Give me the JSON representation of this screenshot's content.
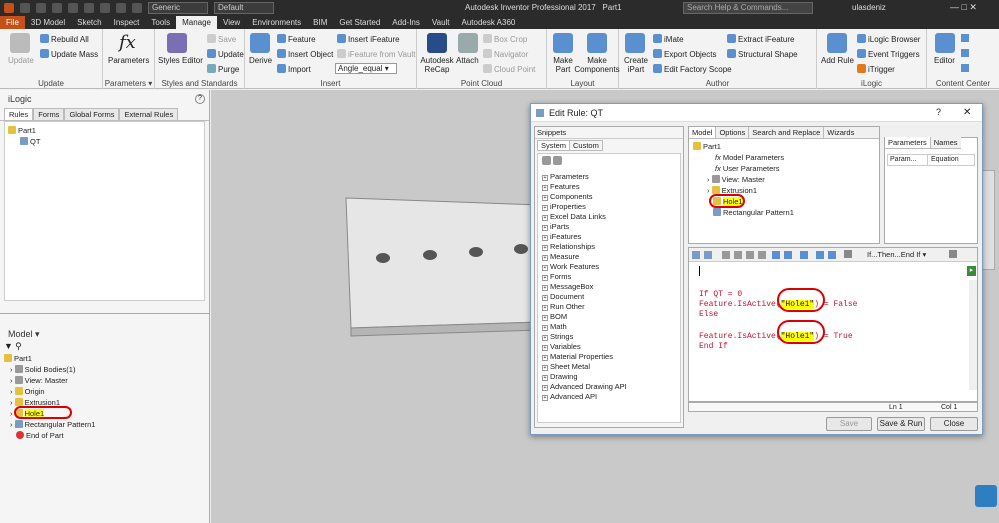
{
  "app": {
    "title": "Autodesk Inventor Professional 2017",
    "doc": "Part1",
    "search_placeholder": "Search Help & Commands...",
    "user": "ulasdeniz",
    "appearance": "Generic",
    "material": "Default"
  },
  "tabs": [
    "File",
    "3D Model",
    "Sketch",
    "Inspect",
    "Tools",
    "Manage",
    "View",
    "Environments",
    "BIM",
    "Get Started",
    "Add-Ins",
    "Vault",
    "Autodesk A360"
  ],
  "ribbon": {
    "update": {
      "update": "Update",
      "rebuild": "Rebuild All",
      "mass": "Update Mass",
      "title": "Update"
    },
    "params": {
      "label": "Parameters",
      "title": "Parameters ▾"
    },
    "styles": {
      "editor": "Styles Editor",
      "save": "Save",
      "update": "Update",
      "purge": "Purge",
      "title": "Styles and Standards"
    },
    "insert": {
      "derive": "Derive",
      "feature": "Feature",
      "object": "Insert Object",
      "import": "Import",
      "ifeature": "Insert iFeature",
      "ifeature_vault": "iFeature from Vault",
      "angle": "Angle_equal",
      "title": "Insert"
    },
    "pointcloud": {
      "recap": "Autodesk ReCap",
      "attach": "Attach",
      "boxcrop": "Box Crop",
      "navigator": "Navigator",
      "cloudpoint": "Cloud Point",
      "title": "Point Cloud"
    },
    "layout": {
      "make_part": "Make Part",
      "make_components": "Make Components",
      "title": "Layout"
    },
    "author": {
      "create": "Create iPart",
      "imate": "iMate",
      "export": "Export Objects",
      "edit_factory": "Edit Factory Scope",
      "extract": "Extract iFeature",
      "structural": "Structural Shape",
      "title": "Author"
    },
    "ilogic": {
      "add_rule": "Add Rule",
      "browser": "iLogic Browser",
      "triggers": "Event Triggers",
      "itrigger": "iTrigger",
      "title": "iLogic"
    },
    "cc": {
      "editor": "Editor",
      "title": "Content Center"
    }
  },
  "ilogic_pane": {
    "title": "iLogic",
    "tabs": [
      "Rules",
      "Forms",
      "Global Forms",
      "External Rules"
    ],
    "part": "Part1",
    "rule": "QT"
  },
  "model_pane": {
    "title": "Model ▾",
    "items": [
      "Part1",
      "Solid Bodies(1)",
      "View: Master",
      "Origin",
      "Extrusion1",
      "Hole1",
      "Rectangular Pattern1",
      "End of Part"
    ]
  },
  "dialog": {
    "title": "Edit Rule: QT",
    "help": "?",
    "close": "✕",
    "snippets_title": "Snippets",
    "snippet_tabs": [
      "System",
      "Custom"
    ],
    "snippets": [
      "Parameters",
      "Features",
      "Components",
      "iProperties",
      "Excel Data Links",
      "iParts",
      "iFeatures",
      "Relationships",
      "Measure",
      "Work Features",
      "Forms",
      "MessageBox",
      "Document",
      "Run Other",
      "BOM",
      "Math",
      "Strings",
      "Variables",
      "Material Properties",
      "Sheet Metal",
      "Drawing",
      "Advanced Drawing API",
      "Advanced API"
    ],
    "model_tabs": [
      "Model",
      "Options",
      "Search and Replace",
      "Wizards"
    ],
    "model_tree": [
      "Part1",
      "Model Parameters",
      "User Parameters",
      "View: Master",
      "Extrusion1",
      "Hole1",
      "Rectangular Pattern1"
    ],
    "param_tabs": [
      "Parameters",
      "Names"
    ],
    "param_cols": [
      "Param...",
      "Equation"
    ],
    "toolbar_dropdown": "If...Then...End If",
    "code": {
      "l1a": "If QT = 0",
      "l2a": "Feature.IsActive(",
      "l2s": "\"Hole1\"",
      "l2b": ") = False",
      "l3": "Else",
      "l4a": "Feature.IsActive(",
      "l4s": "\"Hole1\"",
      "l4b": ") = True",
      "l5": "End If"
    },
    "status": {
      "ln": "Ln 1",
      "col": "Col 1"
    },
    "buttons": {
      "save": "Save",
      "save_run": "Save & Run",
      "close": "Close"
    }
  }
}
